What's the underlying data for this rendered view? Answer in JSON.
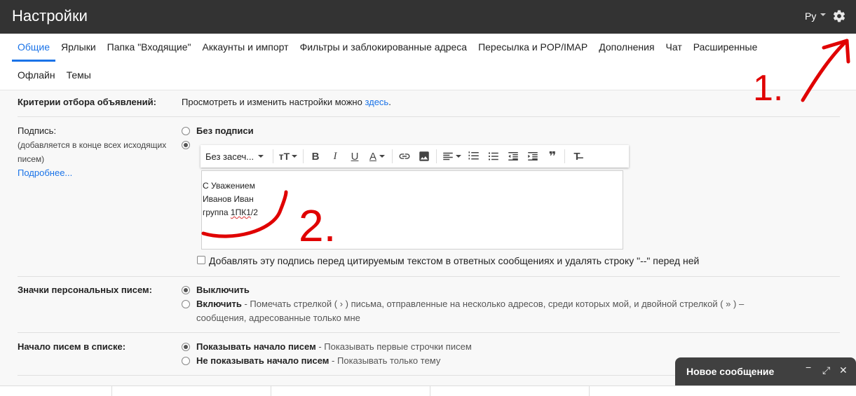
{
  "header": {
    "title": "Настройки",
    "lang_label": "Ру",
    "settings_icon": "gear-icon"
  },
  "tabs_row1": [
    {
      "label": "Общие",
      "active": true
    },
    {
      "label": "Ярлыки"
    },
    {
      "label": "Папка \"Входящие\""
    },
    {
      "label": "Аккаунты и импорт"
    },
    {
      "label": "Фильтры и заблокированные адреса"
    },
    {
      "label": "Пересылка и POP/IMAP"
    },
    {
      "label": "Дополнения"
    },
    {
      "label": "Чат"
    },
    {
      "label": "Расширенные"
    }
  ],
  "tabs_row2": [
    {
      "label": "Офлайн"
    },
    {
      "label": "Темы"
    }
  ],
  "ads": {
    "label": "Критерии отбора объявлений:",
    "text": "Просмотреть и изменить настройки можно ",
    "link": "здесь",
    "suffix": "."
  },
  "signature": {
    "label": "Подпись:",
    "hint_line1": "(добавляется в конце всех исходящих",
    "hint_line2": "писем)",
    "more_link": "Подробнее...",
    "no_signature": "Без подписи",
    "font_name": "Без засеч...",
    "body_lines": [
      "С Уважением",
      "Иванов Иван",
      "группа "
    ],
    "body_misspelled": "1ПК1",
    "body_tail": "/2",
    "checkbox_label": "Добавлять эту подпись перед цитируемым текстом в ответных сообщениях и удалять строку \"--\" перед ней"
  },
  "personal_indicators": {
    "label": "Значки персональных писем:",
    "option_off": "Выключить",
    "option_on": "Включить",
    "option_on_desc": " - Помечать стрелкой ( › ) письма, отправленные на несколько адресов, среди которых мой, и двойной стрелкой ( » ) –",
    "option_on_desc2": "сообщения, адресованные только мне"
  },
  "snippets": {
    "label": "Начало писем в списке:",
    "option_show": "Показывать начало писем",
    "option_show_desc": " - Показывать первые строчки писем",
    "option_hide": "Не показывать начало писем",
    "option_hide_desc": " - Показывать только тему"
  },
  "compose": {
    "title": "Новое сообщение"
  },
  "annotations": {
    "color": "#e00000",
    "label_1": "1.",
    "label_2": "2."
  }
}
